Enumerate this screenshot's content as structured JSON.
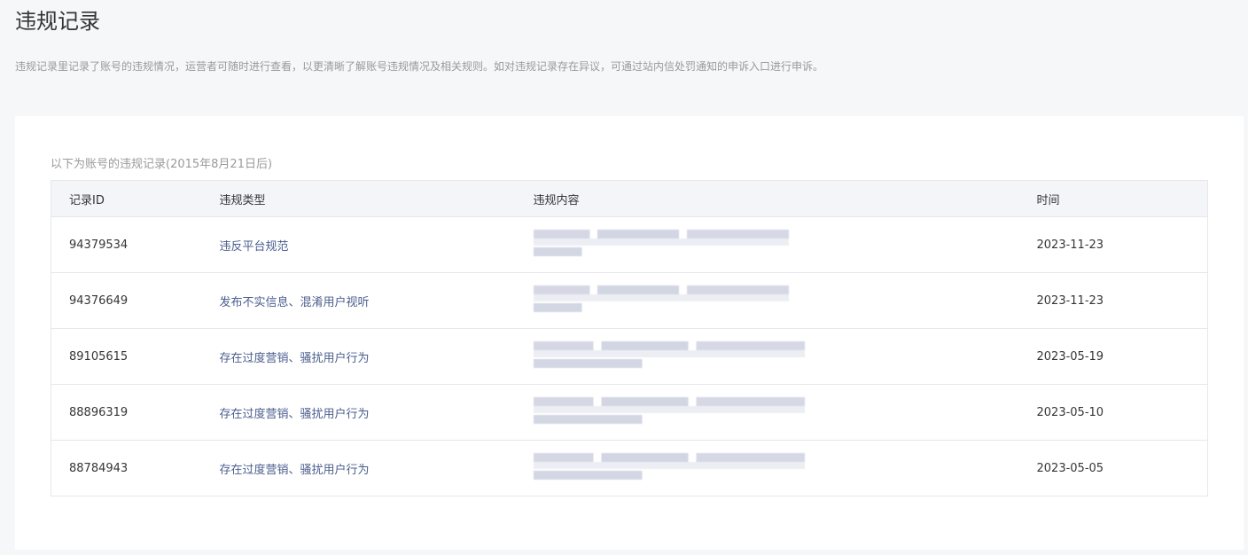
{
  "header": {
    "title": "违规记录",
    "description": "违规记录里记录了账号的违规情况，运营者可随时进行查看，以更清晰了解账号违规情况及相关规则。如对违规记录存在异议，可通过站内信处罚通知的申诉入口进行申诉。"
  },
  "records": {
    "caption": "以下为账号的违规记录(2015年8月21日后)",
    "columns": [
      "记录ID",
      "违规类型",
      "违规内容",
      "时间"
    ],
    "rows": [
      {
        "id": "94379534",
        "type": "违反平台规范",
        "time": "2023-11-23"
      },
      {
        "id": "94376649",
        "type": "发布不实信息、混淆用户视听",
        "time": "2023-11-23"
      },
      {
        "id": "89105615",
        "type": "存在过度营销、骚扰用户行为",
        "time": "2023-05-19"
      },
      {
        "id": "88896319",
        "type": "存在过度营销、骚扰用户行为",
        "time": "2023-05-10"
      },
      {
        "id": "88784943",
        "type": "存在过度营销、骚扰用户行为",
        "time": "2023-05-05"
      }
    ]
  }
}
